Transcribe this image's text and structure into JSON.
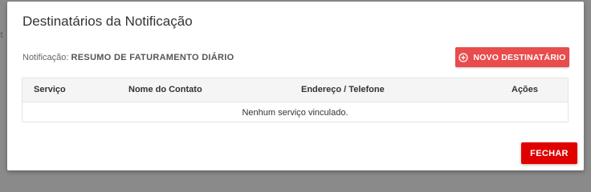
{
  "backdrop": {
    "partial_text": "it"
  },
  "dialog": {
    "title": "Destinatários da Notificação",
    "notification_label": "Notificação:",
    "notification_value": "RESUMO DE FATURAMENTO DIÁRIO",
    "new_recipient_label": "NOVO DESTINATÁRIO",
    "new_recipient_icon": "plus-circle-icon",
    "table": {
      "columns": [
        "Serviço",
        "Nome do Contato",
        "Endereço / Telefone",
        "Ações"
      ],
      "empty_message": "Nenhum serviço vinculado."
    },
    "close_label": "FECHAR"
  },
  "colors": {
    "primary_button": "#e84c4c",
    "close_button": "#e00000"
  }
}
